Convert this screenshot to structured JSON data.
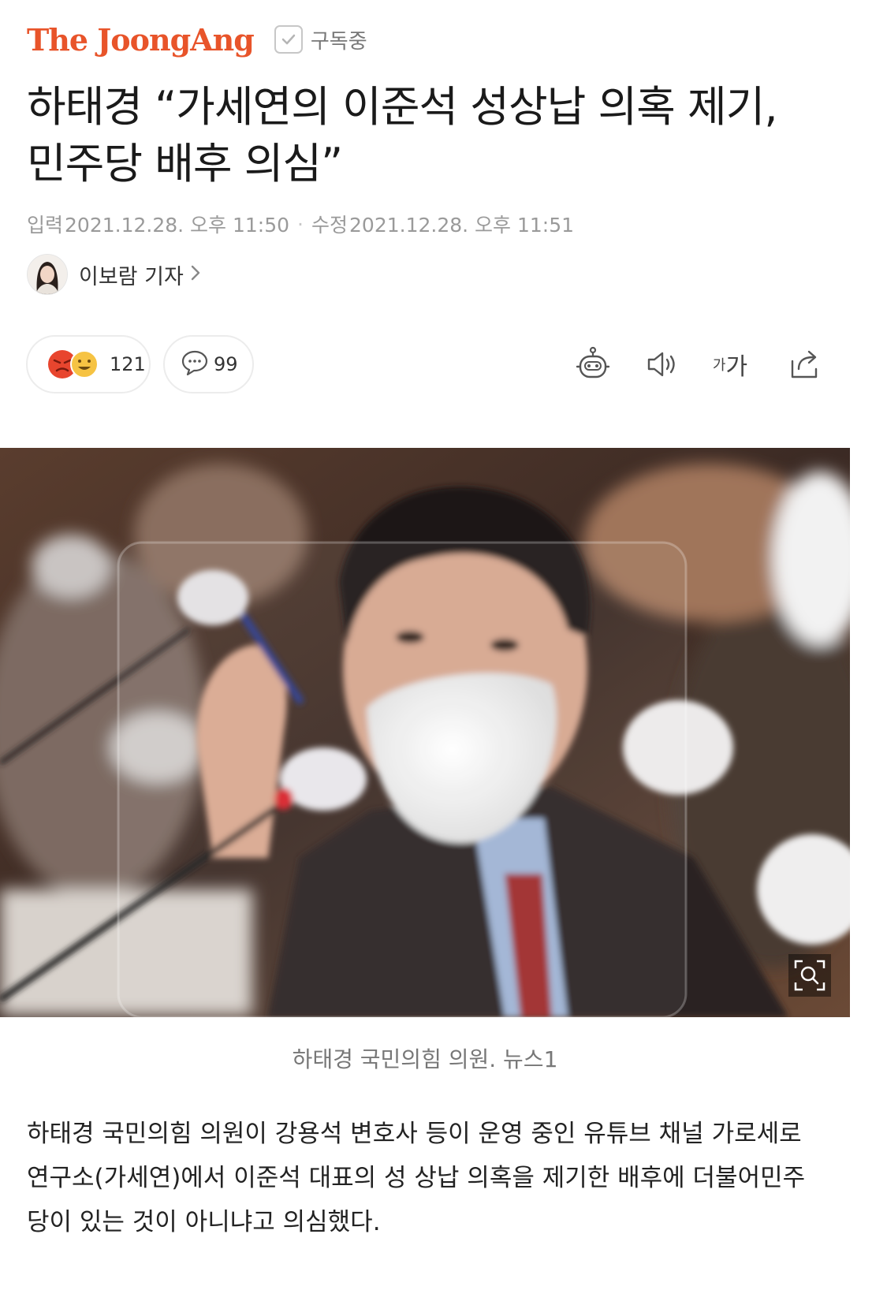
{
  "header": {
    "logo": "The JoongAng",
    "subscribe_label": "구독중"
  },
  "article": {
    "title_line1": "하태경 “가세연의 이준석 성상납 의혹 제기,",
    "title_line2": "민주당 배후 의심”",
    "input_label": "입력",
    "input_time": "2021.12.28. 오후 11:50",
    "edit_label": "수정",
    "edit_time": "2021.12.28. 오후 11:51",
    "reporter": "이보람 기자",
    "reaction_count": "121",
    "comment_count": "99",
    "font_tool_label_small": "가",
    "font_tool_label_large": "가",
    "caption": "하태경 국민의힘 의원. 뉴스1",
    "body": "하태경 국민의힘 의원이 강용석 변호사 등이 운영 중인 유튜브 채널 가로세로연구소(가세연)에서 이준석 대표의 성 상납 의혹을 제기한 배후에 더불어민주당이 있는 것이 아니냐고 의심했다."
  },
  "colors": {
    "brand": "#e8542a",
    "meta_gray": "#9a9a9a",
    "reaction_angry": "#e8452e",
    "reaction_smile": "#f6c343"
  },
  "icons": {
    "subscribe": "check-icon",
    "reporter_more": "chevron-right-icon",
    "reactions": [
      "angry-face-icon",
      "smile-face-icon"
    ],
    "comment": "comment-bubble-icon",
    "toolbar": [
      "robot-summary-icon",
      "speaker-icon",
      "font-size-icon",
      "share-icon"
    ],
    "photo_zoom": "zoom-search-icon"
  }
}
